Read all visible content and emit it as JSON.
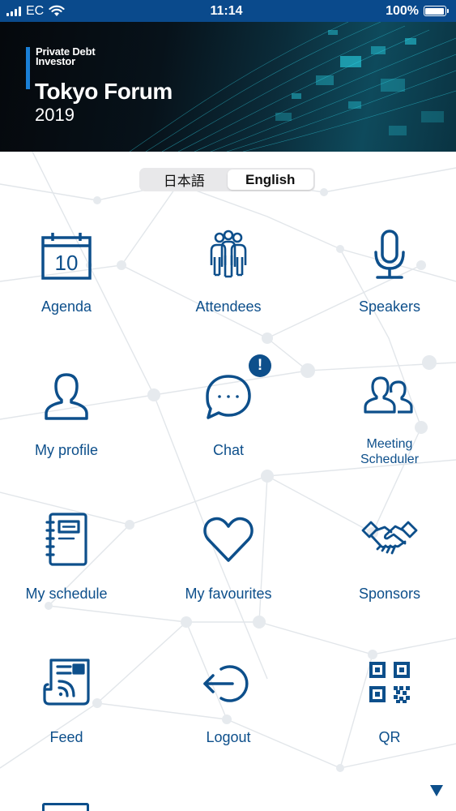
{
  "status_bar": {
    "carrier": "EC",
    "time": "11:14",
    "battery": "100%"
  },
  "banner": {
    "brand_line1": "Private Debt",
    "brand_line2": "Investor",
    "title": "Tokyo Forum",
    "year": "2019"
  },
  "language": {
    "japanese": "日本語",
    "english": "English",
    "selected": "English"
  },
  "menu": {
    "agenda": {
      "label": "Agenda",
      "icon": "calendar-icon",
      "day": "10"
    },
    "attendees": {
      "label": "Attendees",
      "icon": "people-group-icon"
    },
    "speakers": {
      "label": "Speakers",
      "icon": "microphone-icon"
    },
    "my_profile": {
      "label": "My profile",
      "icon": "user-icon"
    },
    "chat": {
      "label": "Chat",
      "icon": "chat-bubble-icon",
      "badge": "!"
    },
    "meeting_scheduler": {
      "label_line1": "Meeting",
      "label_line2": "Scheduler",
      "icon": "two-users-icon"
    },
    "my_schedule": {
      "label": "My schedule",
      "icon": "notebook-icon"
    },
    "my_favourites": {
      "label": "My favourites",
      "icon": "heart-icon"
    },
    "sponsors": {
      "label": "Sponsors",
      "icon": "handshake-icon"
    },
    "feed": {
      "label": "Feed",
      "icon": "rss-document-icon"
    },
    "logout": {
      "label": "Logout",
      "icon": "logout-arrow-icon"
    },
    "qr": {
      "label": "QR",
      "icon": "qr-code-icon"
    }
  },
  "colors": {
    "primary": "#0d4f8b",
    "status_bar": "#0a4a8c",
    "background": "#ffffff"
  }
}
